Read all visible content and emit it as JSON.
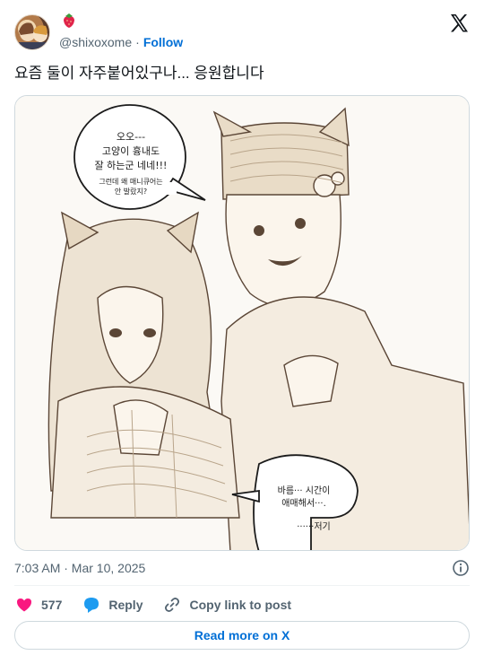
{
  "header": {
    "handle": "@shixoxome",
    "separator": "·",
    "follow_label": "Follow",
    "name_emoji": "strawberry-icon",
    "brand_icon": "x-logo-icon"
  },
  "tweet": {
    "text": "요즘 둘이 자주붙어있구나... 응원합니다"
  },
  "media": {
    "bubble_top_line1": "오오---",
    "bubble_top_line2": "고양이 흉내도",
    "bubble_top_line3": "잘 하는군 네네!!!",
    "bubble_top_small1": "그런데 왜 매니큐어는",
    "bubble_top_small2": "안 발랐지?",
    "bubble_bottom_line1": "바름··· 시간이",
    "bubble_bottom_line2": "애매해서···.",
    "bubble_bottom_line3": "······저기",
    "colors": {
      "line": "#5b4636",
      "sepia": "#e9dfd0"
    }
  },
  "meta": {
    "time": "7:03 AM · Mar 10, 2025"
  },
  "actions": {
    "like_count": "577",
    "reply_label": "Reply",
    "copy_label": "Copy link to post"
  },
  "footer": {
    "read_more_label": "Read more on X"
  },
  "colors": {
    "accent": "#006fd6",
    "like": "#f91880",
    "reply": "#1d9bf0",
    "muted": "#536471"
  }
}
